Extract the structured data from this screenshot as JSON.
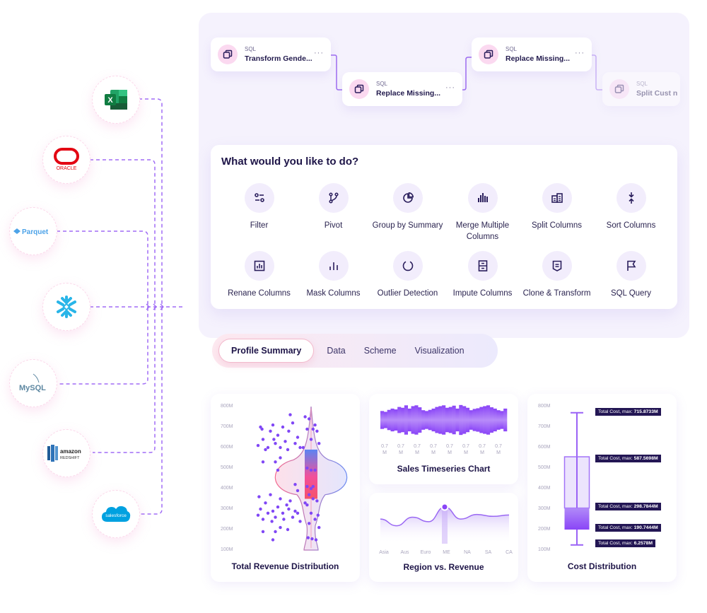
{
  "pipeline": {
    "nodes": [
      {
        "kind": "SQL",
        "name": "Transform Gende...",
        "menu": "···"
      },
      {
        "kind": "SQL",
        "name": "Replace Missing...",
        "menu": "···"
      },
      {
        "kind": "SQL",
        "name": "Replace Missing...",
        "menu": "···"
      },
      {
        "kind": "SQL",
        "name": "Split Cust n",
        "menu": ""
      }
    ]
  },
  "actions": {
    "title": "What would you like to do?",
    "items": [
      {
        "label": "Filter",
        "icon": "filter-icon"
      },
      {
        "label": "Pivot",
        "icon": "branch-icon"
      },
      {
        "label": "Group by Summary",
        "icon": "pie-chart-icon"
      },
      {
        "label": "Merge Multiple Columns",
        "icon": "bar-chart-icon"
      },
      {
        "label": "Split Columns",
        "icon": "split-columns-icon"
      },
      {
        "label": "Sort Columns",
        "icon": "sort-arrows-icon"
      },
      {
        "label": "Renane Columns",
        "icon": "chart-box-icon"
      },
      {
        "label": "Mask Columns",
        "icon": "bars-icon"
      },
      {
        "label": "Outlier Detection",
        "icon": "circle-icon"
      },
      {
        "label": "Impute Columns",
        "icon": "cabinet-icon"
      },
      {
        "label": "Clone & Transform",
        "icon": "shield-doc-icon"
      },
      {
        "label": "SQL Query",
        "icon": "flag-icon"
      }
    ]
  },
  "tabs": [
    {
      "label": "Profile Summary",
      "active": true
    },
    {
      "label": "Data",
      "active": false
    },
    {
      "label": "Scheme",
      "active": false
    },
    {
      "label": "Visualization",
      "active": false
    }
  ],
  "sources": [
    {
      "name": "Excel",
      "label": "X"
    },
    {
      "name": "Oracle",
      "label": "ORACLE"
    },
    {
      "name": "Parquet",
      "label": "Parquet"
    },
    {
      "name": "Snowflake",
      "label": ""
    },
    {
      "name": "MySQL",
      "label": "MySQL"
    },
    {
      "name": "Amazon Redshift",
      "label": "amazon",
      "sublabel": "REDSHIFT"
    },
    {
      "name": "Salesforce",
      "label": "salesforce"
    }
  ],
  "colors": {
    "accent": "#8a4dfa",
    "dark": "#1e1548",
    "tooltip": "#231654",
    "pink": "#f25b8e",
    "blue": "#5b8cf2"
  },
  "chart_data": [
    {
      "type": "scatter",
      "title": "Total Revenue Distribution",
      "subtype": "violin+box+strip",
      "yticks": [
        "800M",
        "700M",
        "600M",
        "500M",
        "400M",
        "300M",
        "200M",
        "100M"
      ],
      "ylim": [
        100,
        800
      ],
      "box": {
        "q1": 350,
        "median": 450,
        "q3": 590,
        "min": 110,
        "max": 790
      },
      "points_left": [
        [
          0.1,
          610
        ],
        [
          0.15,
          700
        ],
        [
          0.18,
          690
        ],
        [
          0.2,
          640
        ],
        [
          0.25,
          590
        ],
        [
          0.3,
          600
        ],
        [
          0.35,
          680
        ],
        [
          0.4,
          710
        ],
        [
          0.42,
          640
        ],
        [
          0.45,
          620
        ],
        [
          0.5,
          660
        ],
        [
          0.55,
          600
        ],
        [
          0.6,
          700
        ],
        [
          0.65,
          630
        ],
        [
          0.7,
          590
        ],
        [
          0.72,
          680
        ],
        [
          0.75,
          760
        ],
        [
          0.8,
          720
        ],
        [
          0.85,
          620
        ],
        [
          0.9,
          650
        ],
        [
          0.95,
          600
        ],
        [
          0.2,
          530
        ],
        [
          0.45,
          530
        ],
        [
          0.5,
          490
        ],
        [
          0.55,
          550
        ],
        [
          0.85,
          420
        ],
        [
          0.9,
          390
        ],
        [
          0.1,
          270
        ],
        [
          0.12,
          360
        ],
        [
          0.15,
          300
        ],
        [
          0.2,
          250
        ],
        [
          0.25,
          330
        ],
        [
          0.3,
          280
        ],
        [
          0.35,
          370
        ],
        [
          0.38,
          240
        ],
        [
          0.4,
          290
        ],
        [
          0.45,
          260
        ],
        [
          0.5,
          310
        ],
        [
          0.55,
          350
        ],
        [
          0.6,
          280
        ],
        [
          0.62,
          250
        ],
        [
          0.68,
          320
        ],
        [
          0.72,
          300
        ],
        [
          0.75,
          340
        ],
        [
          0.8,
          260
        ],
        [
          0.85,
          290
        ],
        [
          0.9,
          280
        ],
        [
          0.95,
          240
        ],
        [
          0.2,
          190
        ],
        [
          0.4,
          150
        ],
        [
          0.45,
          190
        ],
        [
          0.55,
          210
        ],
        [
          0.7,
          200
        ]
      ],
      "points_right": [
        [
          0.1,
          600
        ],
        [
          0.2,
          750
        ],
        [
          0.3,
          690
        ],
        [
          0.4,
          740
        ],
        [
          0.5,
          640
        ],
        [
          0.6,
          690
        ],
        [
          0.7,
          710
        ],
        [
          0.8,
          680
        ],
        [
          0.9,
          620
        ],
        [
          0.3,
          500
        ],
        [
          0.5,
          490
        ],
        [
          0.7,
          490
        ],
        [
          0.3,
          410
        ],
        [
          0.5,
          400
        ],
        [
          0.6,
          410
        ],
        [
          0.4,
          370
        ],
        [
          0.6,
          350
        ],
        [
          0.8,
          340
        ],
        [
          0.2,
          330
        ],
        [
          0.3,
          320
        ],
        [
          0.5,
          280
        ],
        [
          0.7,
          250
        ],
        [
          0.85,
          270
        ],
        [
          0.4,
          230
        ],
        [
          0.9,
          210
        ],
        [
          0.35,
          160
        ],
        [
          0.55,
          155
        ],
        [
          0.75,
          150
        ]
      ]
    },
    {
      "type": "bar",
      "title": "Sales Timeseries Chart",
      "subtype": "mirrored-bars",
      "xticks": [
        "0.7 M",
        "0.7 M",
        "0.7 M",
        "0.7 M",
        "0.7 M",
        "0.7 M",
        "0.7 M",
        "0.7 M"
      ],
      "values": [
        0.55,
        0.5,
        0.62,
        0.7,
        0.65,
        0.8,
        0.75,
        0.9,
        0.7,
        0.85,
        0.9,
        0.78,
        0.6,
        0.55,
        0.62,
        0.7,
        0.8,
        0.85,
        0.9,
        0.75,
        0.8,
        0.88,
        0.7,
        0.92,
        0.85,
        0.75,
        0.6,
        0.68,
        0.72,
        0.8,
        0.85,
        0.9,
        0.78,
        0.7,
        0.6,
        0.55,
        0.7
      ]
    },
    {
      "type": "area",
      "title": "Region vs. Revenue",
      "categories": [
        "Asia",
        "Aus",
        "Euro",
        "ME",
        "NA",
        "SA",
        "CA"
      ],
      "values": [
        0.55,
        0.3,
        0.62,
        0.45,
        1.0,
        0.55,
        0.72,
        0.65,
        0.7
      ],
      "highlight": "ME"
    },
    {
      "type": "box",
      "title": "Cost Distribution",
      "yticks": [
        "800M",
        "700M",
        "600M",
        "500M",
        "400M",
        "300M",
        "200M",
        "100M"
      ],
      "ylim": [
        100,
        800
      ],
      "box": {
        "max": 770,
        "q3": 555,
        "median": 305,
        "q1": 200,
        "min": 125
      },
      "tooltips": [
        {
          "label": "Total Cost, max:",
          "value": "715.8733M"
        },
        {
          "label": "Total Cost, max:",
          "value": "587.5698M"
        },
        {
          "label": "Total Cost, max:",
          "value": "298.7844M"
        },
        {
          "label": "Total Cost, max:",
          "value": "190.7444M"
        },
        {
          "label": "Total Cost, max:",
          "value": "6.2578M"
        }
      ]
    }
  ]
}
